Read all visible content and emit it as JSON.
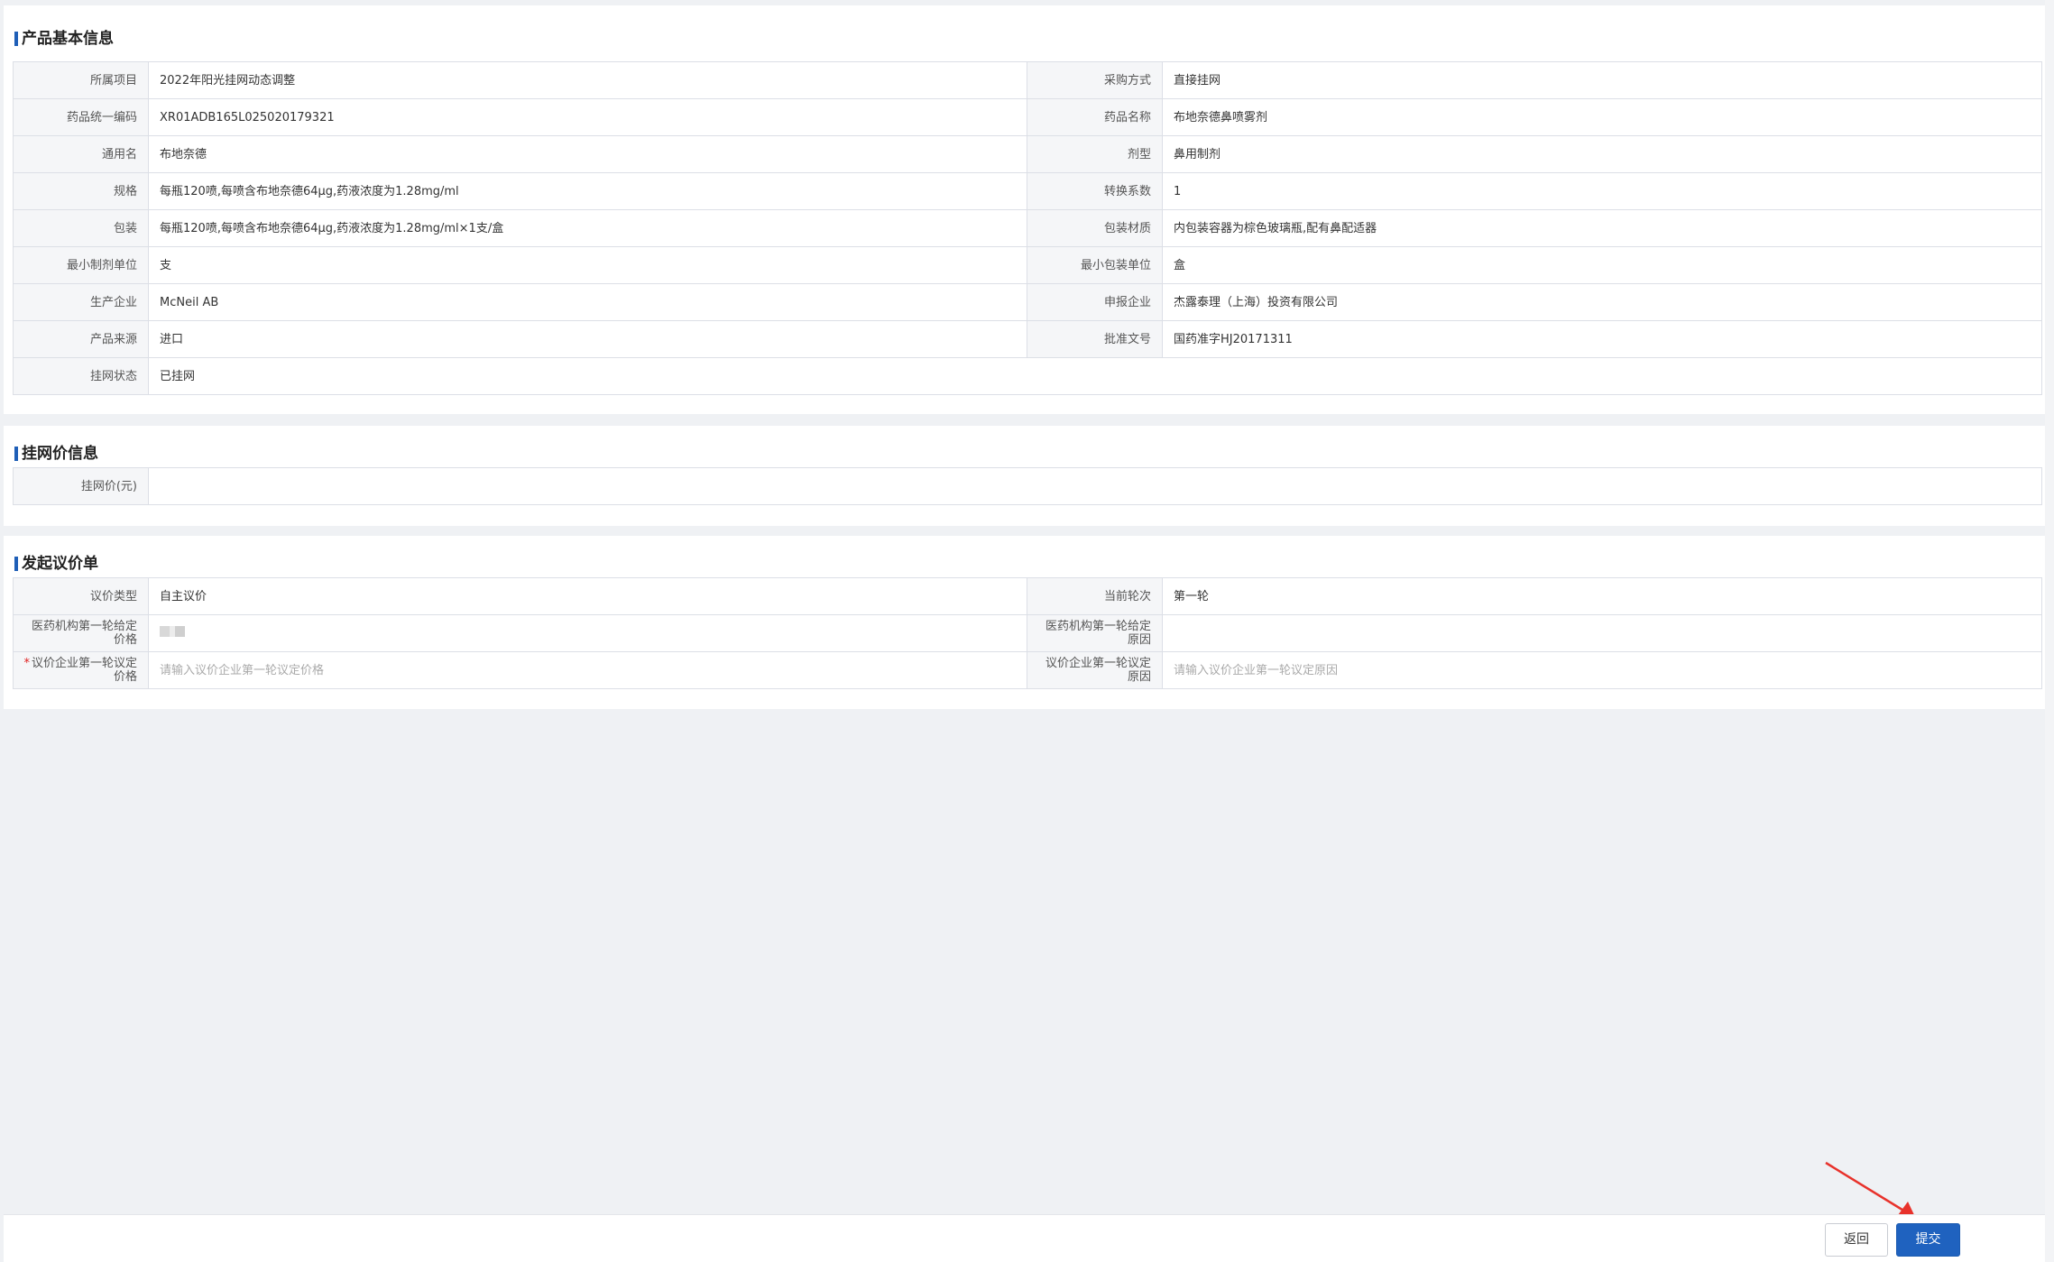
{
  "sections": {
    "basic": {
      "title": "产品基本信息",
      "rows": [
        {
          "l1": "所属项目",
          "v1": "2022年阳光挂网动态调整",
          "l2": "采购方式",
          "v2": "直接挂网"
        },
        {
          "l1": "药品统一编码",
          "v1": "XR01ADB165L025020179321",
          "l2": "药品名称",
          "v2": "布地奈德鼻喷雾剂"
        },
        {
          "l1": "通用名",
          "v1": "布地奈德",
          "l2": "剂型",
          "v2": "鼻用制剂"
        },
        {
          "l1": "规格",
          "v1": "每瓶120喷,每喷含布地奈德64μg,药液浓度为1.28mg/ml",
          "l2": "转换系数",
          "v2": "1"
        },
        {
          "l1": "包装",
          "v1": "每瓶120喷,每喷含布地奈德64μg,药液浓度为1.28mg/ml×1支/盒",
          "l2": "包装材质",
          "v2": "内包装容器为棕色玻璃瓶,配有鼻配适器"
        },
        {
          "l1": "最小制剂单位",
          "v1": "支",
          "l2": "最小包装单位",
          "v2": "盒"
        },
        {
          "l1": "生产企业",
          "v1": "McNeil AB",
          "l2": "申报企业",
          "v2": "杰露泰理（上海）投资有限公司"
        },
        {
          "l1": "产品来源",
          "v1": "进口",
          "l2": "批准文号",
          "v2": "国药准字HJ20171311"
        }
      ],
      "status_label": "挂网状态",
      "status_value": "已挂网"
    },
    "price": {
      "title": "挂网价信息",
      "label": "挂网价(元)",
      "value": ""
    },
    "negotiation": {
      "title": "发起议价单",
      "type_label": "议价类型",
      "type_value": "自主议价",
      "round_label": "当前轮次",
      "round_value": "第一轮",
      "inst_price_label": "医药机构第一轮给定价格",
      "inst_reason_label": "医药机构第一轮给定原因",
      "inst_reason_value": "",
      "required_mark": "*",
      "ent_price_label": "议价企业第一轮议定价格",
      "ent_price_placeholder": "请输入议价企业第一轮议定价格",
      "ent_reason_label": "议价企业第一轮议定原因",
      "ent_reason_placeholder": "请输入议价企业第一轮议定原因"
    }
  },
  "footer": {
    "back_label": "返回",
    "submit_label": "提交"
  },
  "colors": {
    "accent": "#1f62bf",
    "annotation_arrow": "#e8322b"
  }
}
